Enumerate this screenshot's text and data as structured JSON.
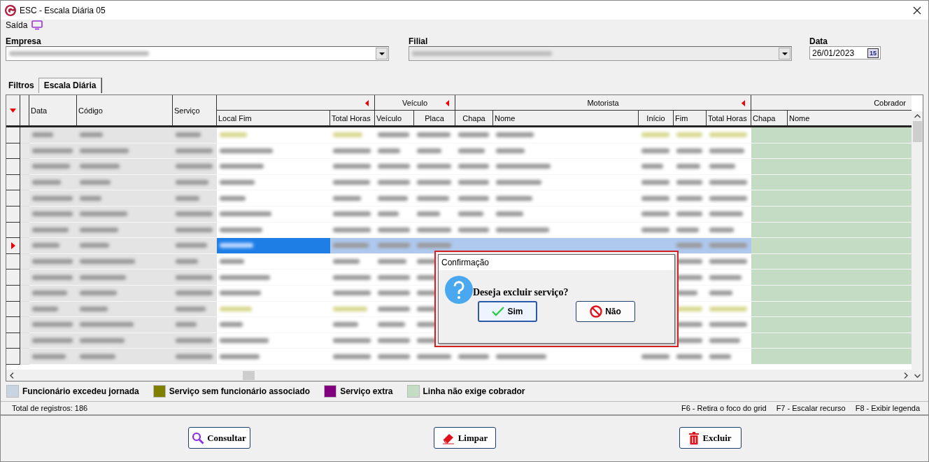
{
  "window": {
    "title": "ESC - Escala Diária 05"
  },
  "menu": [
    {
      "label": "Saída"
    }
  ],
  "filters": {
    "empresa": {
      "label": "Empresa"
    },
    "filial": {
      "label": "Filial"
    },
    "data": {
      "label": "Data",
      "value": "26/01/2023",
      "calendar_glyph": "15"
    }
  },
  "tabs": [
    {
      "label": "Filtros",
      "selected": false
    },
    {
      "label": "Escala Diária",
      "selected": true
    }
  ],
  "grid": {
    "columns": [
      {
        "kind": "single",
        "label": "Data"
      },
      {
        "kind": "single",
        "label": "Código"
      },
      {
        "kind": "single",
        "label": "Serviço"
      },
      {
        "kind": "group",
        "sort_marker": true,
        "children": [
          {
            "label": "Local Fim"
          },
          {
            "label": "Total Horas"
          }
        ]
      },
      {
        "kind": "group",
        "label": "Veículo",
        "sort_marker": true,
        "children": [
          {
            "label": "Veículo"
          },
          {
            "label": "Placa"
          }
        ]
      },
      {
        "kind": "group",
        "label": "Motorista",
        "sort_marker": true,
        "children": [
          {
            "label": "Chapa"
          },
          {
            "label": "Nome"
          },
          {
            "label": "Início"
          },
          {
            "label": "Fim"
          },
          {
            "label": "Total Horas"
          }
        ]
      },
      {
        "kind": "group",
        "label": "Cobrador",
        "sort_marker": false,
        "children": [
          {
            "label": "Chapa"
          },
          {
            "label": "Nome"
          }
        ]
      }
    ],
    "rows": [
      {
        "kind": "pending",
        "selected": false
      },
      {
        "kind": "normal",
        "selected": false
      },
      {
        "kind": "normal",
        "selected": false
      },
      {
        "kind": "normal",
        "selected": false
      },
      {
        "kind": "normal",
        "selected": false
      },
      {
        "kind": "normal",
        "selected": false
      },
      {
        "kind": "normal",
        "selected": false
      },
      {
        "kind": "normal",
        "selected": true
      },
      {
        "kind": "normal",
        "selected": false
      },
      {
        "kind": "normal",
        "selected": false
      },
      {
        "kind": "normal",
        "selected": false
      },
      {
        "kind": "pending",
        "selected": false
      },
      {
        "kind": "normal",
        "selected": false
      },
      {
        "kind": "normal",
        "selected": false
      },
      {
        "kind": "normal",
        "selected": false
      }
    ]
  },
  "legend": [
    {
      "label": "Funcionário excedeu jornada",
      "color": "#c8d4e0"
    },
    {
      "label": "Serviço sem funcionário associado",
      "color": "#808000"
    },
    {
      "label": "Serviço extra",
      "color": "#800080"
    },
    {
      "label": "Linha não exige cobrador",
      "color": "#c4dcc4"
    }
  ],
  "status_bar": {
    "total": "Total de registros: 186",
    "shortcuts": [
      "F6 - Retira o foco do grid",
      "F7 - Escalar recurso",
      "F8 - Exibir legenda"
    ]
  },
  "buttons": [
    {
      "label": "Consultar",
      "kind": "search"
    },
    {
      "label": "Limpar",
      "kind": "clear"
    },
    {
      "label": "Excluir",
      "kind": "delete"
    }
  ],
  "dialog": {
    "title": "Confirmação",
    "message": "Deseja excluir serviço?",
    "buttons": [
      {
        "label": "Sim",
        "kind": "confirm",
        "focused": true
      },
      {
        "label": "Não",
        "kind": "cancel",
        "focused": false
      }
    ]
  }
}
